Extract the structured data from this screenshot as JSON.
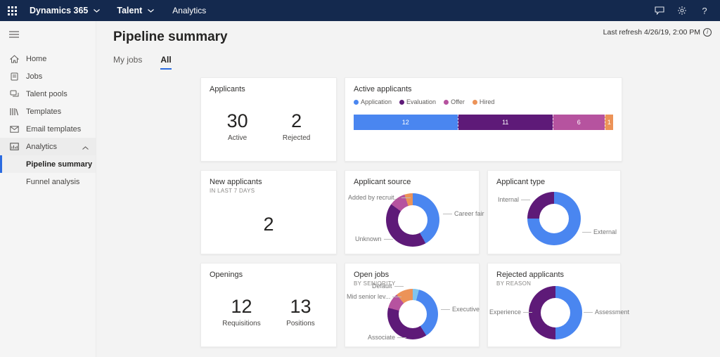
{
  "topbar": {
    "app": "Dynamics 365",
    "module": "Talent",
    "page": "Analytics",
    "help_glyph": "?"
  },
  "sidebar": {
    "items": [
      {
        "label": "Home"
      },
      {
        "label": "Jobs"
      },
      {
        "label": "Talent pools"
      },
      {
        "label": "Templates"
      },
      {
        "label": "Email templates"
      },
      {
        "label": "Analytics"
      }
    ],
    "subitems": [
      {
        "label": "Pipeline summary",
        "selected": true
      },
      {
        "label": "Funnel analysis",
        "selected": false
      }
    ]
  },
  "header": {
    "title": "Pipeline summary",
    "last_refresh": "Last refresh 4/26/19, 2:00 PM",
    "info_glyph": "i"
  },
  "tabs": {
    "my_jobs": "My jobs",
    "all": "All"
  },
  "cards": {
    "applicants": {
      "title": "Applicants",
      "metrics": [
        {
          "value": "30",
          "label": "Active"
        },
        {
          "value": "2",
          "label": "Rejected"
        }
      ]
    },
    "new_applicants": {
      "title": "New applicants",
      "subtitle": "IN LAST 7 DAYS",
      "value": "2"
    },
    "openings": {
      "title": "Openings",
      "metrics": [
        {
          "value": "12",
          "label": "Requisitions"
        },
        {
          "value": "13",
          "label": "Positions"
        }
      ]
    }
  },
  "colors": {
    "blue": "#4a86f0",
    "dark_purple": "#5e1a78",
    "magenta": "#b6539f",
    "orange": "#ec9358",
    "light_blue": "#7fc5f0",
    "accent": "#2b6be0",
    "topbar_bg": "#14294e"
  },
  "chart_data": {
    "active_applicants": {
      "type": "bar",
      "stacked": true,
      "orientation": "horizontal",
      "title": "Active applicants",
      "legend_position": "top",
      "segments": [
        {
          "label": "Application",
          "value": 12,
          "color": "#4a86f0"
        },
        {
          "label": "Evaluation",
          "value": 11,
          "color": "#5e1a78"
        },
        {
          "label": "Offer",
          "value": 6,
          "color": "#b6539f"
        },
        {
          "label": "Hired",
          "value": 1,
          "color": "#ec9358"
        }
      ]
    },
    "applicant_source": {
      "type": "pie",
      "title": "Applicant source",
      "segments": [
        {
          "label": "Career fair",
          "pct": 42,
          "color": "#4a86f0"
        },
        {
          "label": "Unknown",
          "pct": 43,
          "color": "#5e1a78"
        },
        {
          "label": "Added by recruit...",
          "pct": 10,
          "color": "#b6539f"
        },
        {
          "label": "",
          "pct": 5,
          "color": "#ec9358"
        }
      ]
    },
    "applicant_type": {
      "type": "pie",
      "title": "Applicant type",
      "segments": [
        {
          "label": "External",
          "pct": 75,
          "color": "#4a86f0"
        },
        {
          "label": "Internal",
          "pct": 25,
          "color": "#5e1a78"
        }
      ]
    },
    "open_jobs": {
      "type": "pie",
      "title": "Open jobs",
      "subtitle": "BY SENIORITY",
      "segments": [
        {
          "label": "",
          "pct": 4,
          "color": "#7fc5f0"
        },
        {
          "label": "Executive",
          "pct": 37,
          "color": "#4a86f0"
        },
        {
          "label": "Associate",
          "pct": 38,
          "color": "#5e1a78"
        },
        {
          "label": "Mid senior lev...",
          "pct": 10,
          "color": "#b6539f"
        },
        {
          "label": "Default",
          "pct": 11,
          "color": "#ec9358"
        }
      ]
    },
    "rejected_applicants": {
      "type": "pie",
      "title": "Rejected applicants",
      "subtitle": "BY REASON",
      "segments": [
        {
          "label": "Assessment",
          "pct": 50,
          "color": "#4a86f0"
        },
        {
          "label": "Experience",
          "pct": 50,
          "color": "#5e1a78"
        }
      ]
    }
  }
}
